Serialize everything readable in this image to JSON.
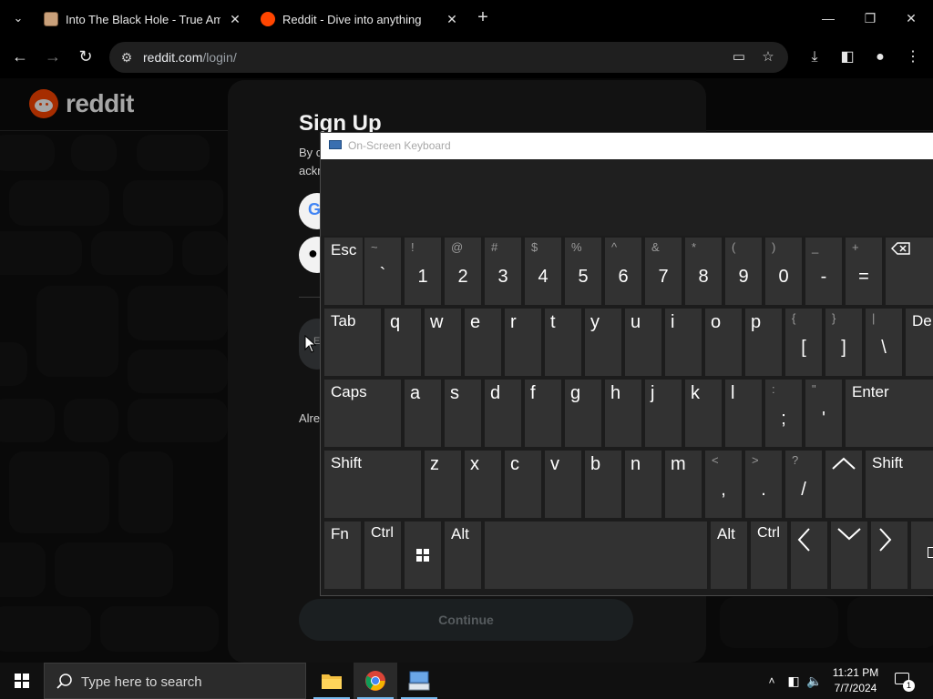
{
  "browser": {
    "tabs": [
      {
        "title": "Into The Black Hole - True Amo",
        "close": "✕"
      },
      {
        "title": "Reddit - Dive into anything",
        "close": "✕"
      }
    ],
    "new_tab": "+",
    "url_domain": "reddit.com",
    "url_path": "/login/"
  },
  "page": {
    "logo_text": "reddit",
    "modal": {
      "title": "Sign Up",
      "intro_line1": "By c",
      "intro_line2": "ackn",
      "email_placeholder": "E",
      "already": "Alre",
      "continue_label": "Continue"
    }
  },
  "osk": {
    "title": "On-Screen Keyboard",
    "rows": {
      "row1": [
        {
          "label": "Esc"
        },
        {
          "shift": "~",
          "main": "`"
        },
        {
          "shift": "!",
          "main": "1"
        },
        {
          "shift": "@",
          "main": "2"
        },
        {
          "shift": "#",
          "main": "3"
        },
        {
          "shift": "$",
          "main": "4"
        },
        {
          "shift": "%",
          "main": "5"
        },
        {
          "shift": "^",
          "main": "6"
        },
        {
          "shift": "&",
          "main": "7"
        },
        {
          "shift": "*",
          "main": "8"
        },
        {
          "shift": "(",
          "main": "9"
        },
        {
          "shift": ")",
          "main": "0"
        },
        {
          "shift": "_",
          "main": "-"
        },
        {
          "shift": "+",
          "main": "="
        }
      ],
      "row2": [
        {
          "label": "Tab"
        },
        {
          "main": "q"
        },
        {
          "main": "w"
        },
        {
          "main": "e"
        },
        {
          "main": "r"
        },
        {
          "main": "t"
        },
        {
          "main": "y"
        },
        {
          "main": "u"
        },
        {
          "main": "i"
        },
        {
          "main": "o"
        },
        {
          "main": "p"
        },
        {
          "shift": "{",
          "main": "["
        },
        {
          "shift": "}",
          "main": "]"
        },
        {
          "shift": "|",
          "main": "\\"
        },
        {
          "label": "De"
        }
      ],
      "row3": [
        {
          "label": "Caps"
        },
        {
          "main": "a"
        },
        {
          "main": "s"
        },
        {
          "main": "d"
        },
        {
          "main": "f"
        },
        {
          "main": "g"
        },
        {
          "main": "h"
        },
        {
          "main": "j"
        },
        {
          "main": "k"
        },
        {
          "main": "l"
        },
        {
          "shift": ":",
          "main": ";"
        },
        {
          "shift": "\"",
          "main": "'"
        },
        {
          "label": "Enter"
        }
      ],
      "row4": [
        {
          "label": "Shift"
        },
        {
          "main": "z"
        },
        {
          "main": "x"
        },
        {
          "main": "c"
        },
        {
          "main": "v"
        },
        {
          "main": "b"
        },
        {
          "main": "n"
        },
        {
          "main": "m"
        },
        {
          "shift": "<",
          "main": ","
        },
        {
          "shift": ">",
          "main": "."
        },
        {
          "shift": "?",
          "main": "/"
        },
        {
          "label": "Shift"
        }
      ],
      "row5": [
        {
          "label": "Fn"
        },
        {
          "label": "Ctrl"
        },
        {
          "label": "Alt"
        },
        {
          "label": "Alt"
        },
        {
          "label": "Ctrl"
        }
      ]
    }
  },
  "taskbar": {
    "search_placeholder": "Type here to search",
    "time": "11:21 PM",
    "date": "7/7/2024",
    "notification_count": "1"
  }
}
